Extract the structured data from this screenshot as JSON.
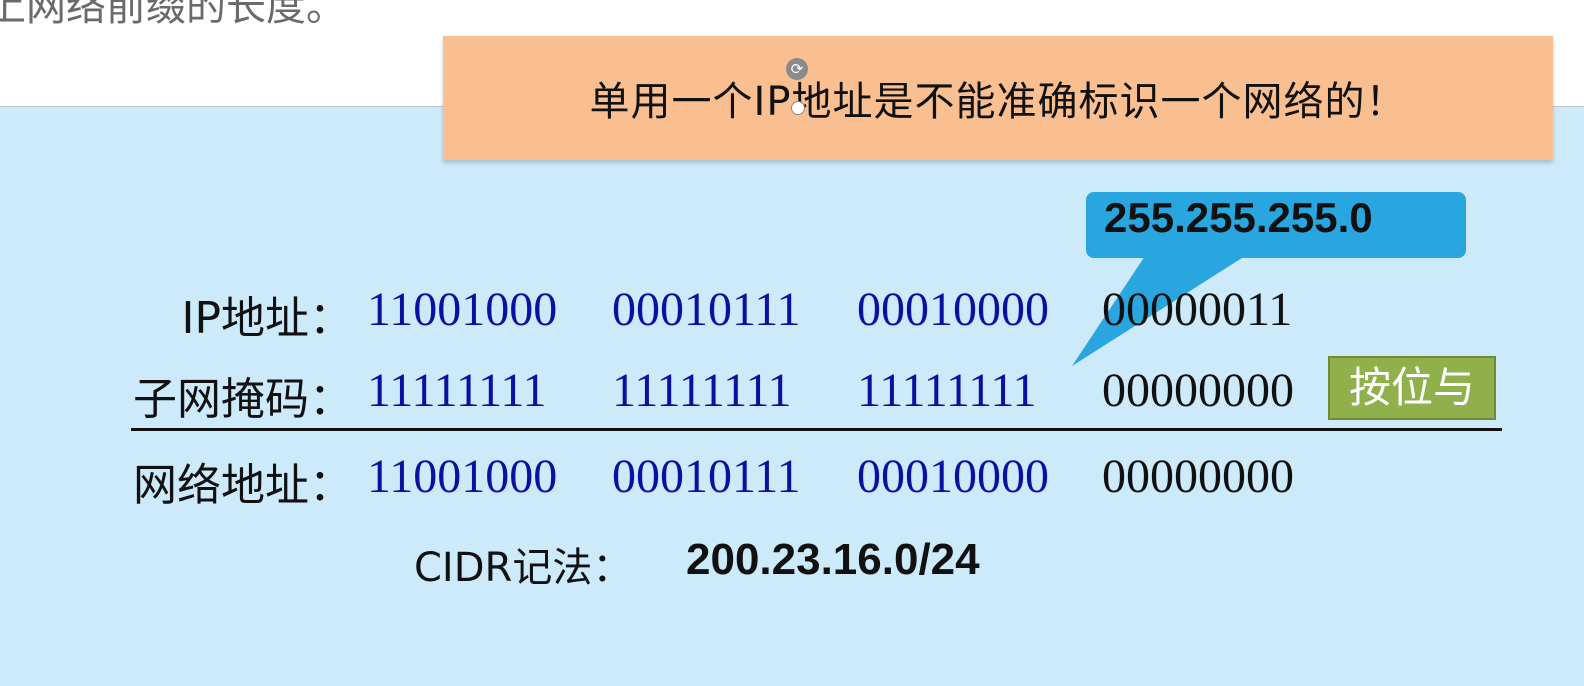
{
  "top_text": "上网络前缀的长度。",
  "warning": {
    "text": "单用一个IP地址是不能准确标识一个网络的！",
    "color": "#f9bf90"
  },
  "callout": {
    "text": "255.255.255.0",
    "color": "#29a6df"
  },
  "rows": {
    "ip": {
      "label": "IP地址：",
      "octets": [
        "11001000",
        "00010111",
        "00010000",
        "00000011"
      ]
    },
    "mask": {
      "label": "子网掩码：",
      "octets": [
        "11111111",
        "11111111",
        "11111111",
        "00000000"
      ]
    },
    "network": {
      "label": "网络地址：",
      "octets": [
        "11001000",
        "00010111",
        "00010000",
        "00000000"
      ]
    }
  },
  "and_button": {
    "label": "按位与",
    "color": "#8fb04a"
  },
  "cidr": {
    "label": "CIDR记法：",
    "value": "200.23.16.0/24"
  },
  "colors": {
    "slide_background": "#cdeafb",
    "octet_blue": "#0c10a0"
  }
}
